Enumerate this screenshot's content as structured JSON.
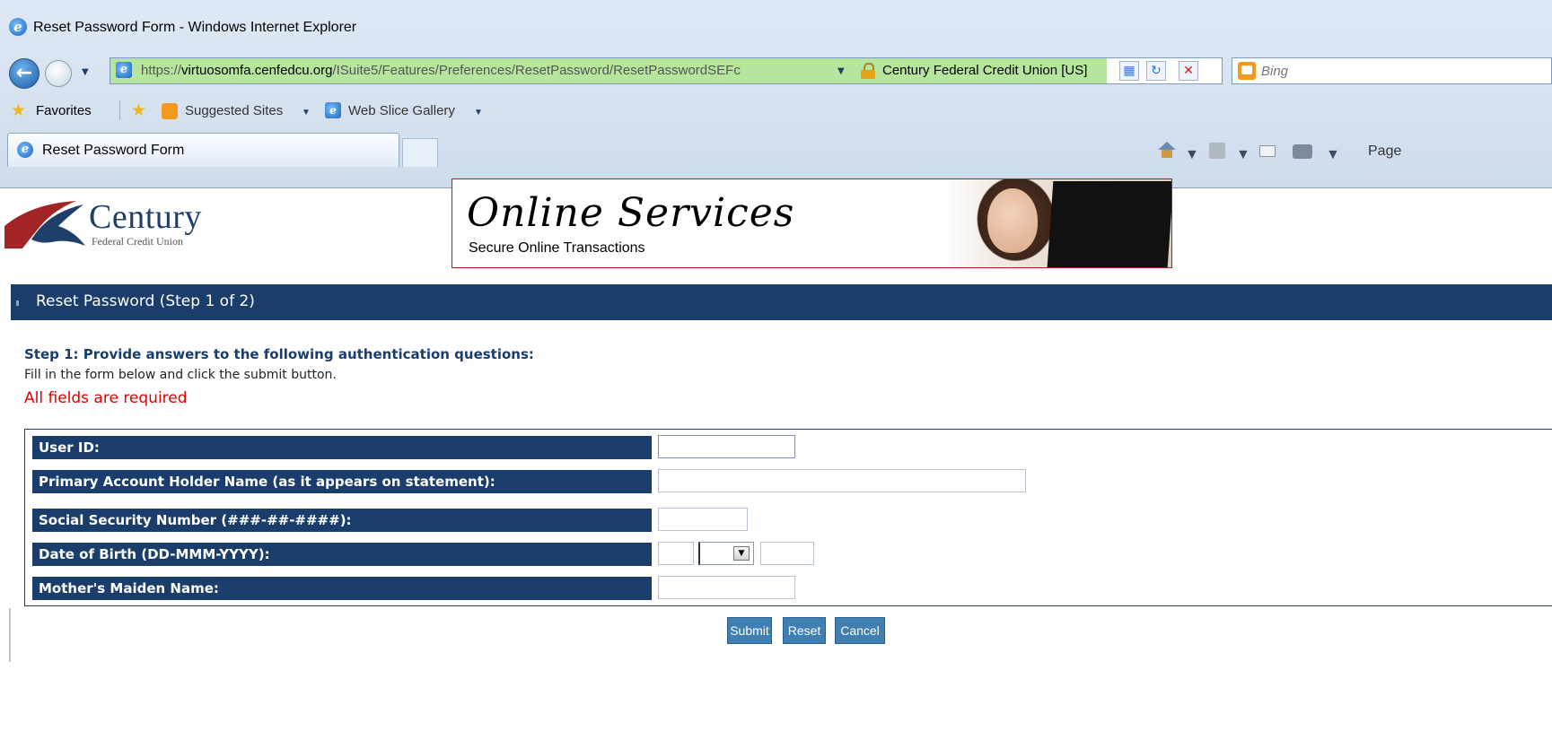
{
  "browser": {
    "window_title": "Reset Password Form - Windows Internet Explorer",
    "address": {
      "url_prefix": "https://",
      "url_host": "virtuosomfa.cenfedcu.org",
      "url_path": "/ISuite5/Features/Preferences/ResetPassword/ResetPasswordSEFc",
      "certificate_label": "Century Federal Credit Union [US]"
    },
    "search": {
      "placeholder": "Bing"
    },
    "favorites_bar": {
      "favorites_label": "Favorites",
      "suggested_sites_label": "Suggested Sites",
      "web_slice_gallery_label": "Web Slice Gallery"
    },
    "tab": {
      "label": "Reset Password Form"
    },
    "command_bar": {
      "page_label": "Page"
    },
    "colors": {
      "address_secure": "#b6e69e"
    }
  },
  "site": {
    "logo": {
      "name": "Century",
      "subtitle": "Federal Credit Union"
    },
    "banner": {
      "title": "Online Services",
      "subtitle": "Secure Online Transactions"
    },
    "colors": {
      "primary": "#1a3d6b",
      "accent": "#a32424",
      "required": "#e00000",
      "button": "#3f7fb1"
    }
  },
  "form": {
    "step_title": "Reset Password (Step 1 of 2)",
    "instruction_heading": "Step 1: Provide answers to the following authentication questions:",
    "instruction_text": "Fill in the form below and click the submit button.",
    "required_notice": "All fields are required",
    "fields": {
      "user_id": {
        "label": "User ID:",
        "value": ""
      },
      "holder_name": {
        "label": "Primary Account Holder Name (as it appears on statement):",
        "value": ""
      },
      "ssn": {
        "label": "Social Security Number (###-##-####):",
        "value": ""
      },
      "dob": {
        "label": "Date of Birth (DD-MMM-YYYY):",
        "day": "",
        "month": "",
        "year": ""
      },
      "maiden_name": {
        "label": "Mother's Maiden Name:",
        "value": ""
      }
    },
    "buttons": {
      "submit": "Submit",
      "reset": "Reset",
      "cancel": "Cancel"
    }
  }
}
